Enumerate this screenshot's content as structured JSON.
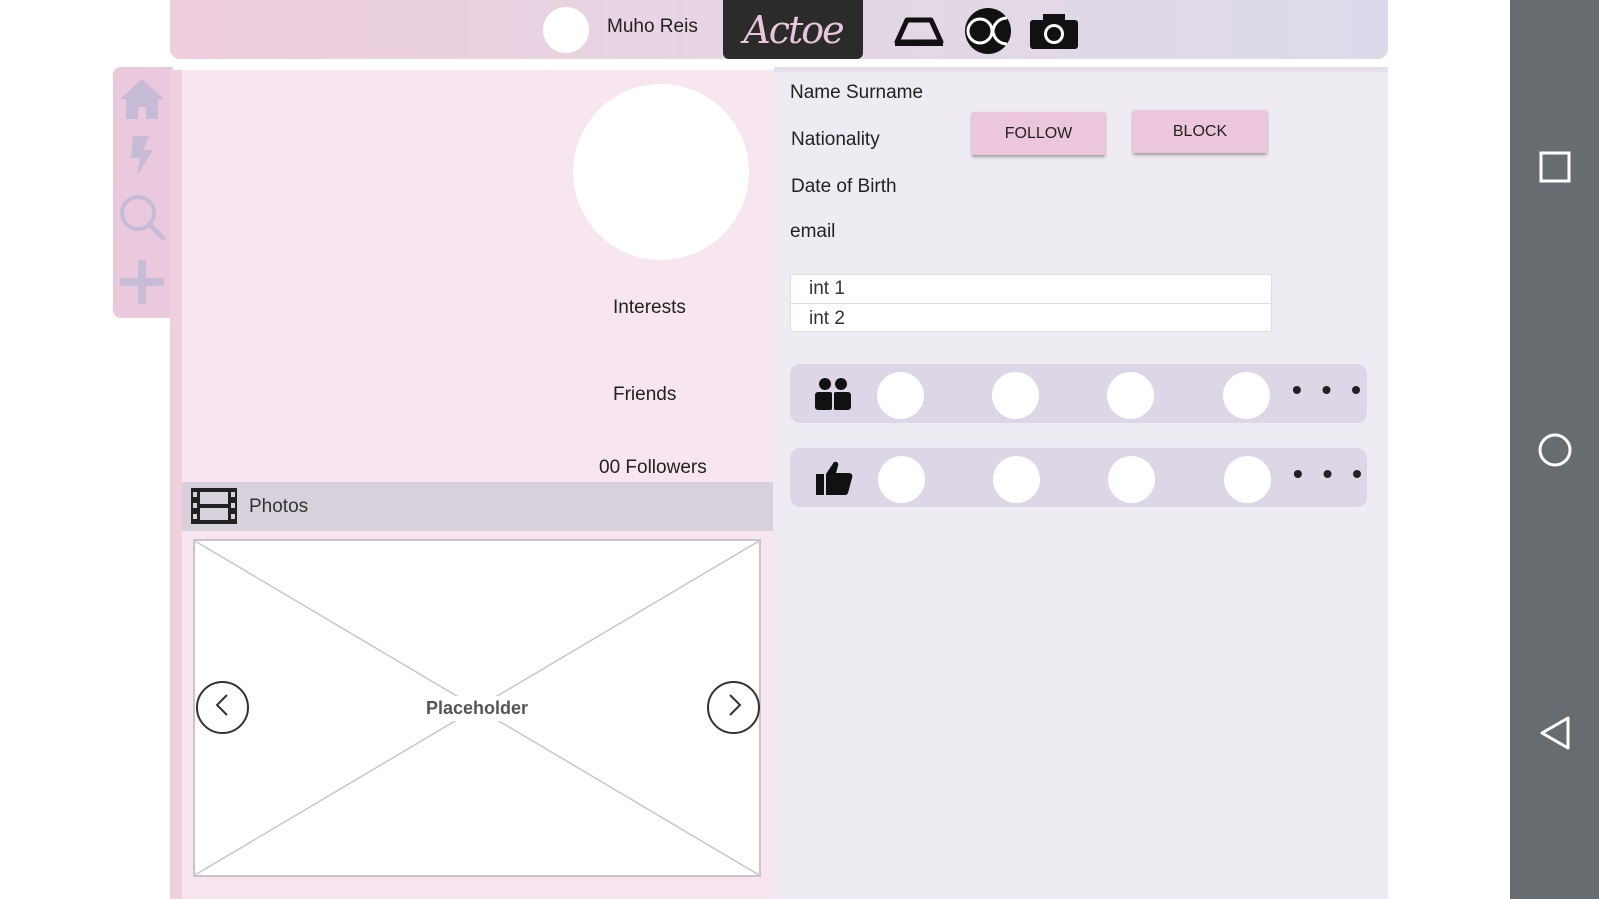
{
  "topbar": {
    "username": "Muho Reis",
    "logo_text": "Actoe",
    "icons": [
      "hat-icon",
      "brand-circle-icon",
      "camera-icon"
    ]
  },
  "leftnav": {
    "icons": [
      "home-icon",
      "lightning-icon",
      "search-icon",
      "plus-icon"
    ]
  },
  "profile": {
    "interests_label": "Interests",
    "friends_label": "Friends",
    "followers_label": "00 Followers",
    "name": "Name Surname",
    "nationality": "Nationality",
    "dob": "Date of Birth",
    "email": "email",
    "follow_label": "FOLLOW",
    "block_label": "BLOCK",
    "interests": [
      "int 1",
      "int 2"
    ],
    "more_label": "• • •"
  },
  "photos": {
    "label": "Photos",
    "placeholder": "Placeholder"
  },
  "colors": {
    "accent_pink": "#ecc6da",
    "panel_pink": "#f7e6ef",
    "panel_lavender": "#efebf3",
    "nav_icon": "#c7bcd8",
    "android_bar": "#676c70"
  }
}
